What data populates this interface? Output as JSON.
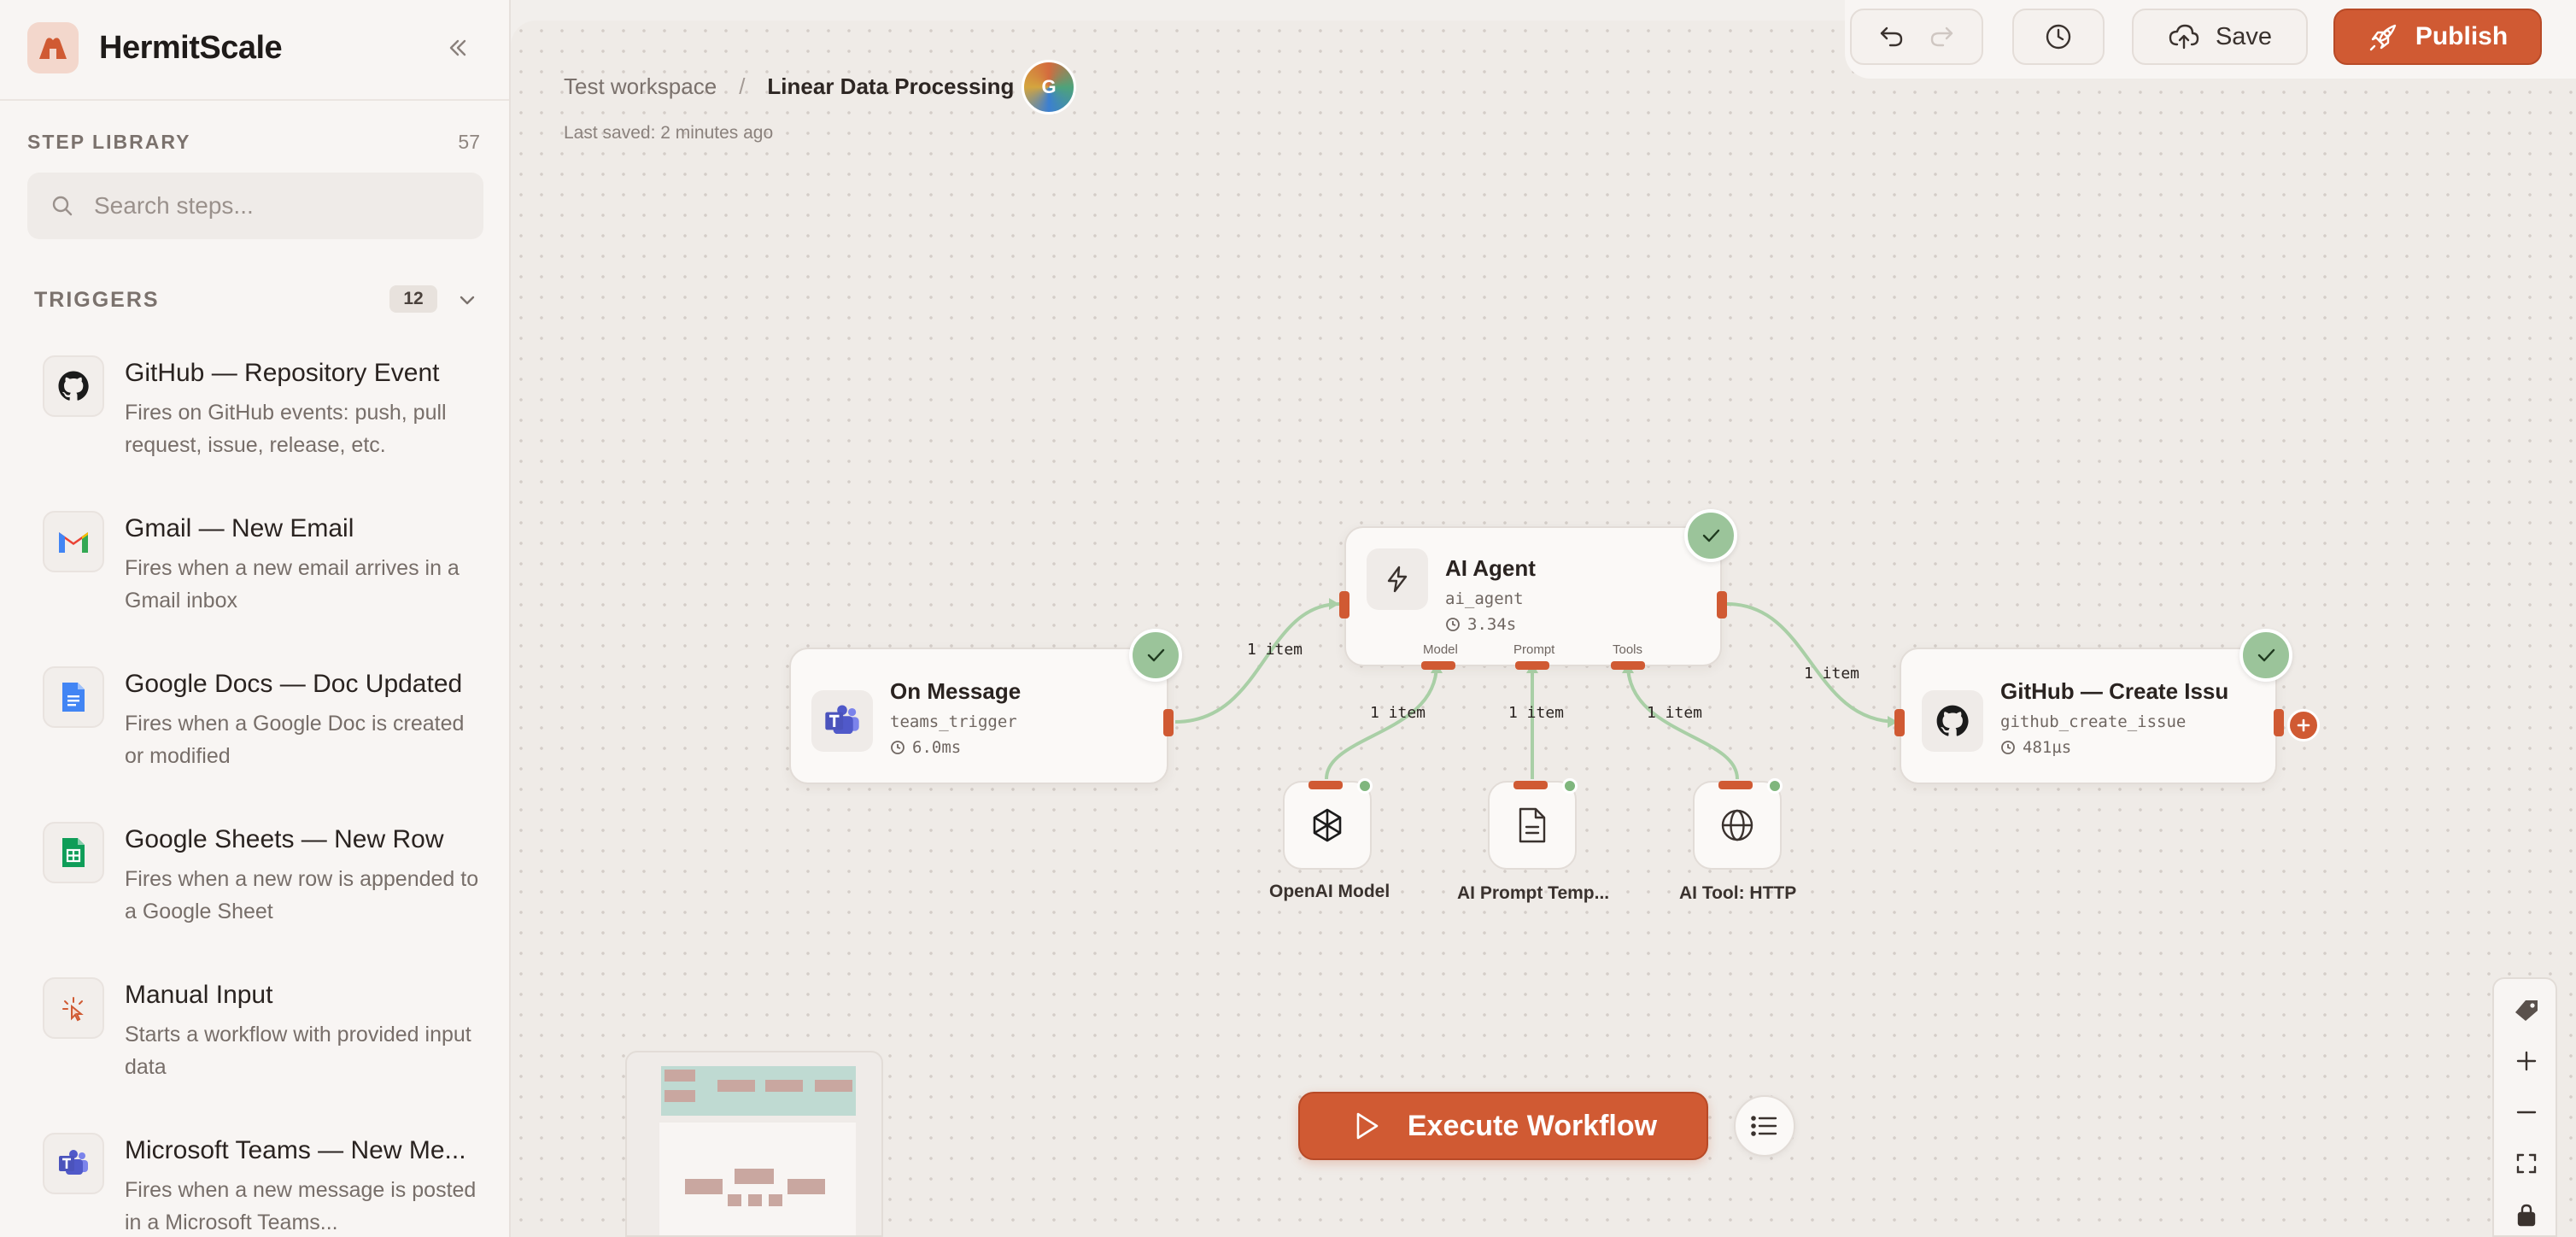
{
  "app": {
    "name": "HermitScale"
  },
  "sidebar": {
    "library_title": "STEP LIBRARY",
    "library_count": "57",
    "search_placeholder": "Search steps...",
    "section": {
      "title": "TRIGGERS",
      "count": "12"
    },
    "steps": [
      {
        "title": "GitHub — Repository Event",
        "desc": "Fires on GitHub events: push, pull request, issue, release, etc.",
        "icon": "github-icon"
      },
      {
        "title": "Gmail — New Email",
        "desc": "Fires when a new email arrives in a Gmail inbox",
        "icon": "gmail-icon"
      },
      {
        "title": "Google Docs — Doc Updated",
        "desc": "Fires when a Google Doc is created or modified",
        "icon": "google-docs-icon"
      },
      {
        "title": "Google Sheets — New Row",
        "desc": "Fires when a new row is appended to a Google Sheet",
        "icon": "google-sheets-icon"
      },
      {
        "title": "Manual Input",
        "desc": "Starts a workflow with provided input data",
        "icon": "cursor-click-icon"
      },
      {
        "title": "Microsoft Teams — New Me...",
        "desc": "Fires when a new message is posted in a Microsoft Teams...",
        "icon": "teams-icon"
      }
    ]
  },
  "header": {
    "workspace": "Test workspace",
    "separator": "/",
    "workflow_name": "Linear Data Processing",
    "avatar_initial": "G",
    "last_saved": "Last saved: 2 minutes ago"
  },
  "toolbar": {
    "save_label": "Save",
    "publish_label": "Publish"
  },
  "nodes": {
    "on_message": {
      "title": "On Message",
      "type": "teams_trigger",
      "time": "6.0ms"
    },
    "ai_agent": {
      "title": "AI Agent",
      "type": "ai_agent",
      "time": "3.34s",
      "ports": [
        "Model",
        "Prompt",
        "Tools"
      ]
    },
    "github": {
      "title": "GitHub — Create Issu",
      "type": "github_create_issue",
      "time": "481µs"
    },
    "openai": {
      "label": "OpenAI Model"
    },
    "prompt": {
      "label": "AI Prompt Temp..."
    },
    "http": {
      "label": "AI Tool: HTTP"
    }
  },
  "edges": {
    "label": "1 item"
  },
  "canvas": {
    "execute_label": "Execute Workflow"
  },
  "colors": {
    "accent": "#d05a33",
    "success": "#9bc49a",
    "edge": "#a9cfa6"
  }
}
